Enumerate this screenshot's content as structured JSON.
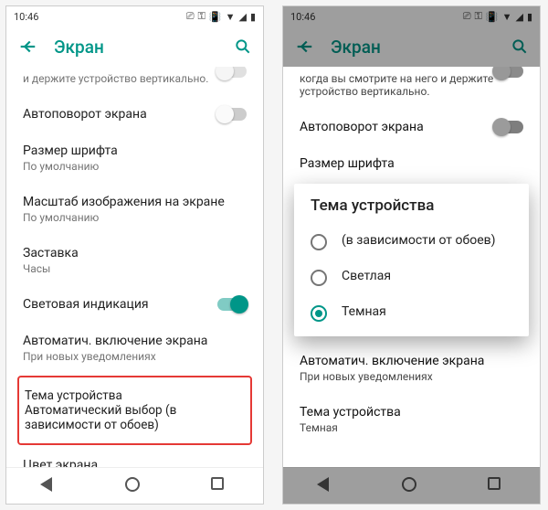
{
  "status": {
    "time": "10:46"
  },
  "header": {
    "title": "Экран"
  },
  "left": {
    "partial_text": "и держите устройство вертикально.",
    "autorotate": {
      "label": "Автоповорот экрана"
    },
    "font_size": {
      "label": "Размер шрифта",
      "sub": "По умолчанию"
    },
    "display_scale": {
      "label": "Масштаб изображения на экране",
      "sub": "По умолчанию"
    },
    "screensaver": {
      "label": "Заставка",
      "sub": "Часы"
    },
    "light_indication": {
      "label": "Световая индикация"
    },
    "auto_on": {
      "label": "Автоматич. включение экрана",
      "sub": "При новых уведомлениях"
    },
    "device_theme": {
      "label": "Тема устройства",
      "sub": "Автоматический выбор (в зависимости от обоев)"
    },
    "screen_color": {
      "label": "Цвет экрана"
    }
  },
  "right": {
    "partial_text": "когда вы смотрите на него и держите устройство вертикально.",
    "autorotate": {
      "label": "Автоповорот экрана"
    },
    "font_size": {
      "label": "Размер шрифта"
    },
    "auto_on": {
      "label": "Автоматич. включение экрана",
      "sub": "При новых уведомлениях"
    },
    "device_theme": {
      "label": "Тема устройства",
      "sub": "Темная"
    }
  },
  "dialog": {
    "title": "Тема устройства",
    "options": {
      "auto": "(в зависимости от обоев)",
      "light": "Светлая",
      "dark": "Темная"
    }
  }
}
